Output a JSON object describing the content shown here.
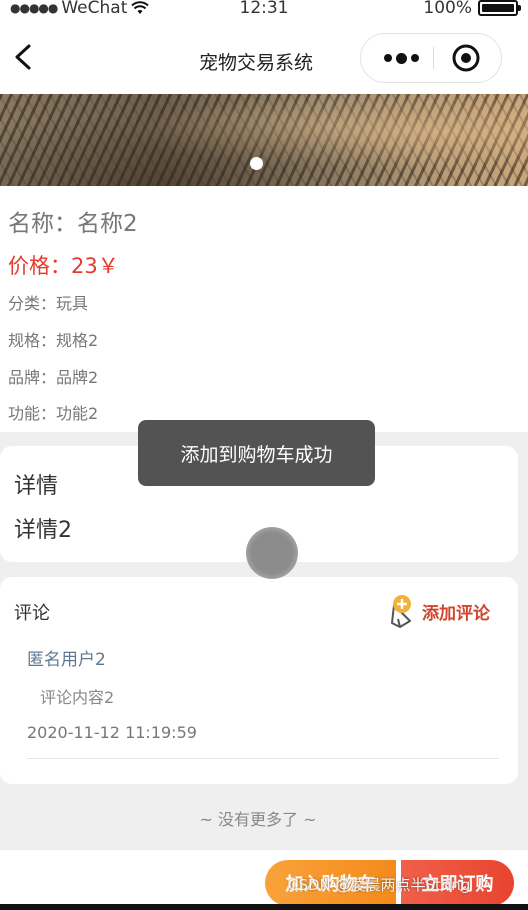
{
  "status_bar": {
    "carrier": "WeChat",
    "time": "12:31",
    "battery": "100%"
  },
  "nav": {
    "title": "宠物交易系统"
  },
  "product": {
    "name": "名称：名称2",
    "price": "价格：23￥",
    "attributes": [
      "分类：玩具",
      "规格：规格2",
      "品牌：品牌2",
      "功能：功能2"
    ]
  },
  "details": {
    "heading": "详情",
    "content": "详情2"
  },
  "comments": {
    "heading": "评论",
    "add_label": "添加评论",
    "items": [
      {
        "user": "匿名用户2",
        "content": "评论内容2",
        "date": "2020-11-12 11:19:59"
      }
    ]
  },
  "no_more": "~ 没有更多了 ~",
  "toast": "添加到购物车成功",
  "footer": {
    "add_to_cart": "加入购物车",
    "buy_now": "立即订购"
  },
  "watermark": "CSDN @凌晨两点半String",
  "colors": {
    "price": "#e53b2c",
    "cart_button": "#f48a1b",
    "buy_button": "#e8442f",
    "comment_user": "#5f7891"
  }
}
